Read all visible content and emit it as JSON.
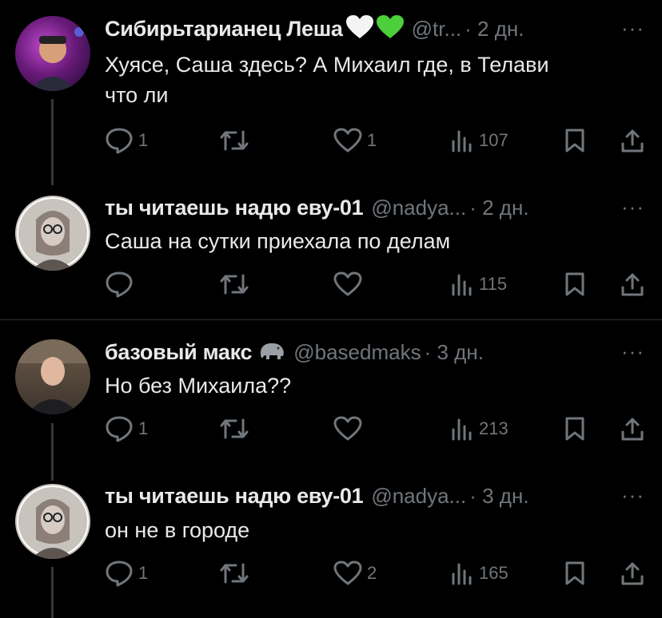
{
  "tweets": [
    {
      "name": "Сибирьтарианец Леша",
      "handle": "@tr...",
      "time": "· 2 дн.",
      "more": "···",
      "text_line1": "Хуясе, Саша здесь? А Михаил где, в Телави",
      "text_line2": "что ли",
      "replies": "1",
      "retweets": "",
      "likes": "1",
      "views": "107",
      "avatar_icon": "avatar-photo",
      "emoji": [
        "white-heart",
        "green-heart"
      ]
    },
    {
      "name": "ты читаешь надю еву-01",
      "handle": "@nadya...",
      "time": "· 2 дн.",
      "more": "···",
      "text_line1": "Саша на сутки приехала по делам",
      "replies": "",
      "retweets": "",
      "likes": "",
      "views": "115",
      "avatar_icon": "avatar-sketch"
    },
    {
      "name": "базовый макс",
      "handle": "@basedmaks",
      "time": "· 3 дн.",
      "more": "···",
      "text_line1": "Но без Михаила??",
      "replies": "1",
      "retweets": "",
      "likes": "",
      "views": "213",
      "avatar_icon": "avatar-photo",
      "emoji": [
        "elephant"
      ]
    },
    {
      "name": "ты читаешь надю еву-01",
      "handle": "@nadya...",
      "time": "· 3 дн.",
      "more": "···",
      "text_line1": "он не в городе",
      "replies": "1",
      "retweets": "",
      "likes": "2",
      "views": "165",
      "avatar_icon": "avatar-sketch"
    }
  ],
  "colors": {
    "background": "#000000",
    "text": "#e7e9ea",
    "muted": "#71767b",
    "divider": "#2f3336",
    "green_heart": "#4ccf3a"
  }
}
